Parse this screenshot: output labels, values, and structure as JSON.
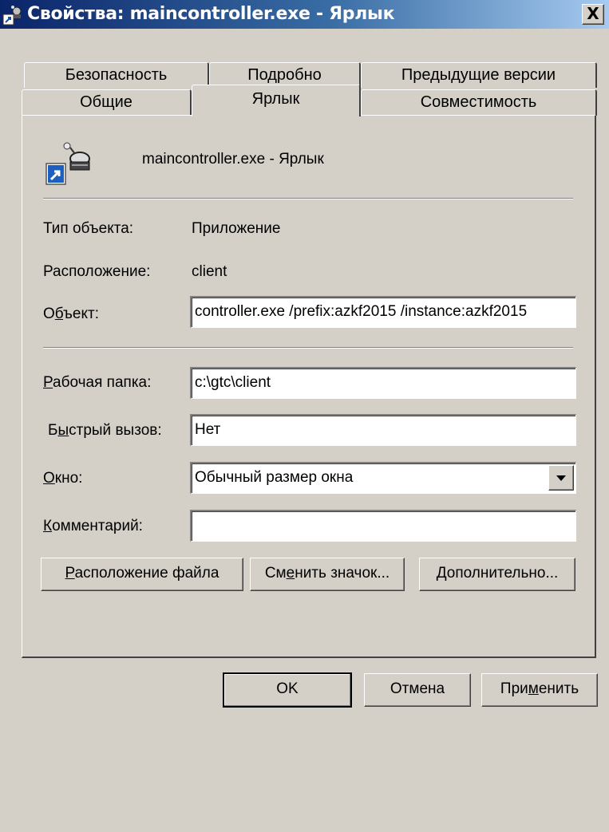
{
  "window": {
    "title": "Свойства: maincontroller.exe - Ярлык",
    "close_symbol": "X"
  },
  "tabs_row1": [
    {
      "label": "Безопасность"
    },
    {
      "label": "Подробно"
    },
    {
      "label": "Предыдущие версии"
    }
  ],
  "tabs_row2": [
    {
      "label": "Общие"
    },
    {
      "label": "Ярлык",
      "active": true
    },
    {
      "label": "Совместимость"
    }
  ],
  "header": {
    "name": "maincontroller.exe - Ярлык",
    "icon": "shortcut-app-icon"
  },
  "props": {
    "type_label": "Тип объекта:",
    "type_value": "Приложение",
    "location_label": "Расположение:",
    "location_value": "client",
    "target_label_pre": "О",
    "target_label_u": "б",
    "target_label_post": "ъект:",
    "target_value": "controller.exe /prefix:azkf2015 /instance:azkf2015",
    "workdir_label_u": "Р",
    "workdir_label_post": "абочая папка:",
    "workdir_value": "c:\\gtc\\client",
    "hotkey_label_pre": "Б",
    "hotkey_label_u": "ы",
    "hotkey_label_post": "стрый вызов:",
    "hotkey_value": "Нет",
    "window_label_u": "О",
    "window_label_post": "кно:",
    "window_value": "Обычный размер окна",
    "comment_label_u": "К",
    "comment_label_post": "омментарий:",
    "comment_value": ""
  },
  "actions": {
    "open_location_u": "Р",
    "open_location_post": "асположение файла",
    "change_icon_pre": "См",
    "change_icon_u": "е",
    "change_icon_post": "нить значок...",
    "advanced_u": "Д",
    "advanced_post": "ополнительно..."
  },
  "footer": {
    "ok": "OK",
    "cancel": "Отмена",
    "apply_pre": "При",
    "apply_u": "м",
    "apply_post": "енить"
  },
  "colors": {
    "dialog_bg": "#d4d0c8",
    "titlebar_start": "#0a246a",
    "titlebar_end": "#a6caf0"
  }
}
